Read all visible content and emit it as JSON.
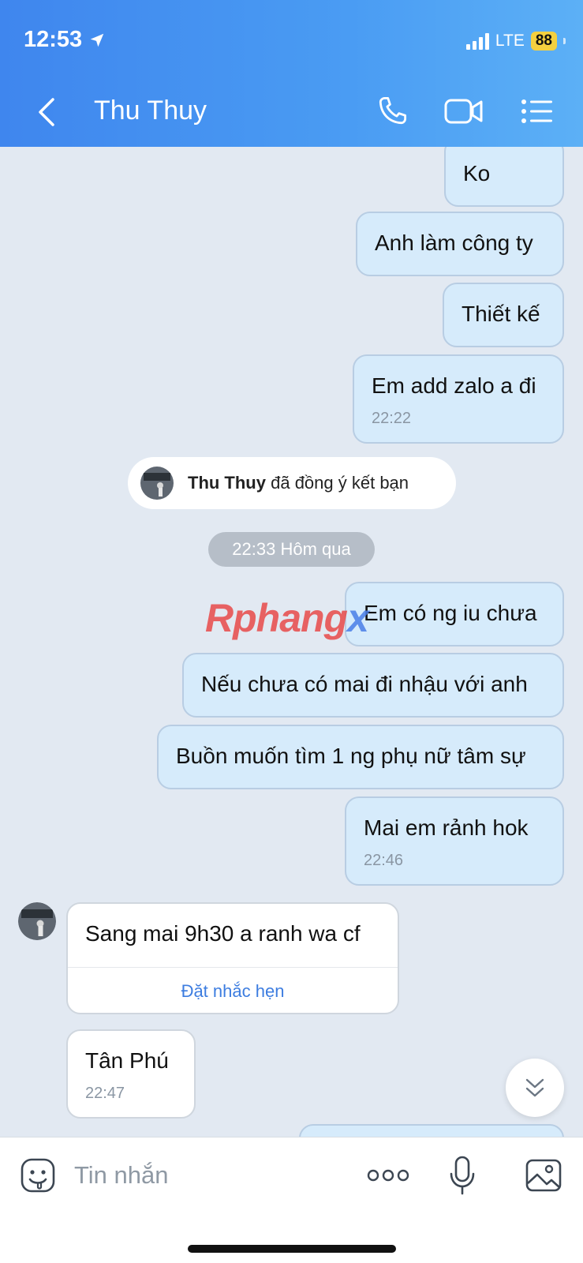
{
  "status": {
    "time": "12:53",
    "network": "LTE",
    "battery": "88"
  },
  "header": {
    "title": "Thu Thuy",
    "icons": {
      "back": "chevron-left-icon",
      "call": "phone-icon",
      "video": "video-camera-icon",
      "menu": "list-menu-icon"
    }
  },
  "messages": [
    {
      "from": "me",
      "text": "Ko"
    },
    {
      "from": "me",
      "text": "Anh làm công ty"
    },
    {
      "from": "me",
      "text": "Thiết kế"
    },
    {
      "from": "me",
      "text": "Em add zalo a đi",
      "time": "22:22"
    },
    {
      "from": "me",
      "text": "Em có ng iu chưa"
    },
    {
      "from": "me",
      "text": "Nếu chưa có mai đi nhậu với anh"
    },
    {
      "from": "me",
      "text": "Buồn muốn tìm 1 ng phụ nữ tâm sự"
    },
    {
      "from": "me",
      "text": "Mai em rảnh hok",
      "time": "22:46"
    },
    {
      "from": "them",
      "text": "Sang mai 9h30 a ranh wa cf",
      "action": "Đặt nhắc hẹn"
    },
    {
      "from": "them",
      "text": "Tân Phú",
      "time": "22:47"
    }
  ],
  "system": {
    "friend_name": "Thu Thuy",
    "friend_accept_text": "đã đồng ý kết bạn",
    "date_separator": "22:33 Hôm qua"
  },
  "watermark": {
    "part1": "Rphang",
    "part2": "x"
  },
  "input": {
    "placeholder": "Tin nhắn"
  },
  "colors": {
    "header_start": "#3f86ee",
    "header_end": "#5cb0f6",
    "my_bubble": "#d6ebfb",
    "link": "#3d7de0"
  }
}
